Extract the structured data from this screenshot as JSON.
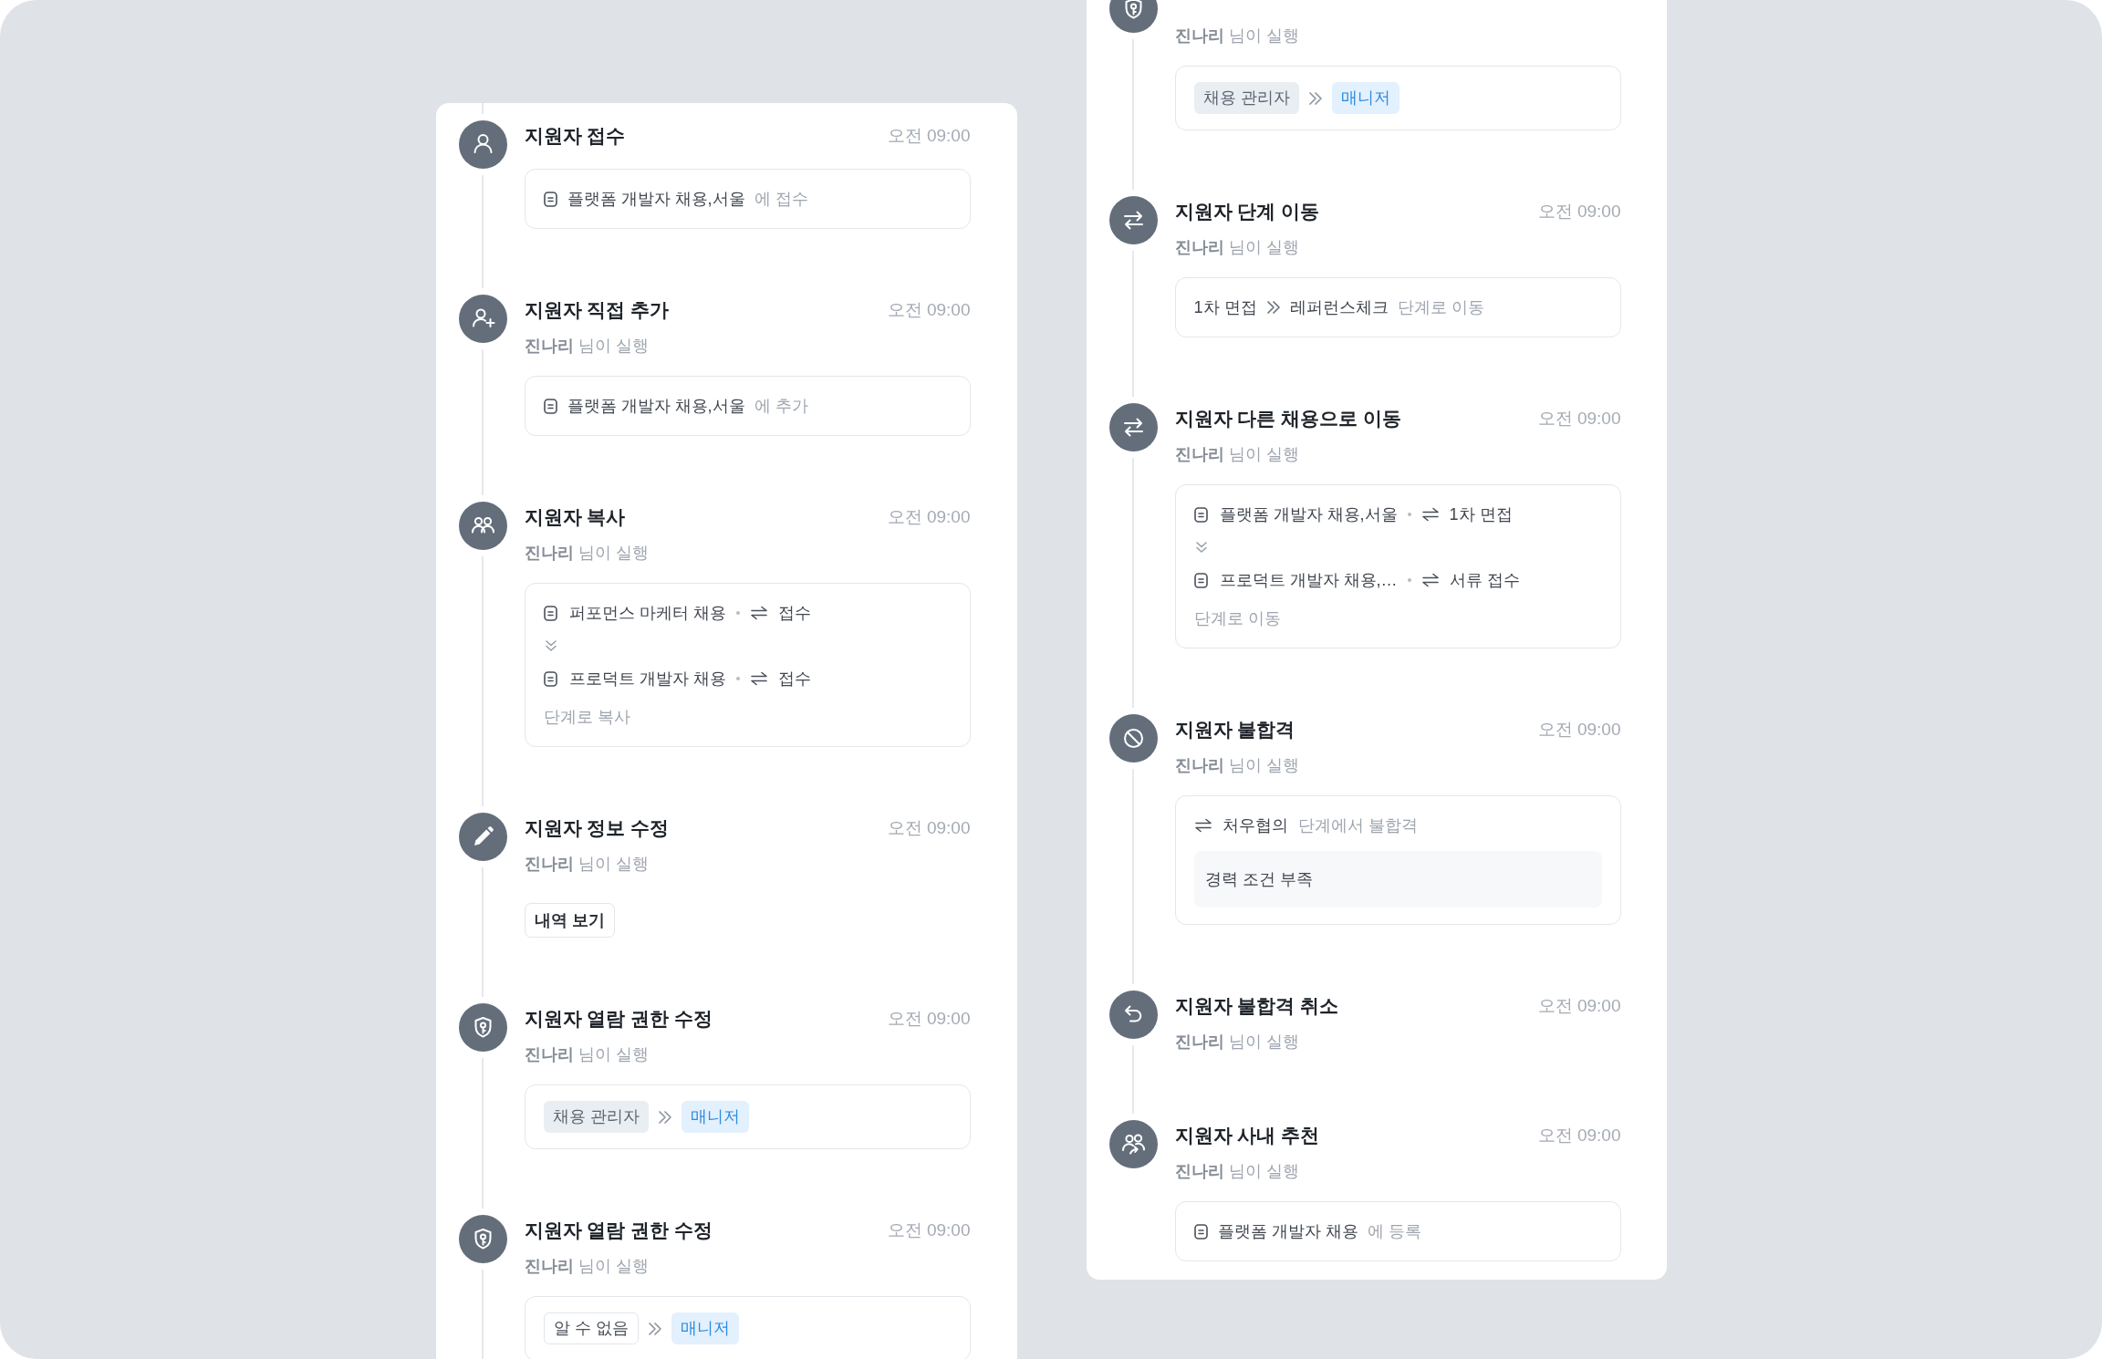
{
  "columns": [
    {
      "continues": true,
      "events": [
        {
          "kind": "apply",
          "title": "지원자 접수",
          "time": "오전 09:00",
          "detail": {
            "kind": "posting",
            "posting": "플랫폼 개발자 채용,서울",
            "suffix": "에 접수"
          }
        },
        {
          "kind": "add",
          "title": "지원자 직접 추가",
          "time": "오전 09:00",
          "actor": "**진나리** 님이 실행",
          "detail": {
            "kind": "posting",
            "posting": "플랫폼 개발자 채용,서울",
            "suffix": "에 추가"
          }
        },
        {
          "kind": "copy",
          "title": "지원자 복사",
          "time": "오전 09:00",
          "actor": "**진나리** 님이 실행",
          "detail": {
            "kind": "transfer",
            "rows": [
              {
                "posting": "퍼포먼스 마케터 채용",
                "stage": "접수"
              },
              {
                "posting": "프로덕트 개발자 채용",
                "stage": "접수"
              }
            ],
            "note": "단계로 복사"
          }
        },
        {
          "kind": "edit",
          "title": "지원자 정보 수정",
          "time": "오전 09:00",
          "actor": "**진나리** 님이 실행",
          "detail": {
            "kind": "button",
            "label": "내역 보기"
          }
        },
        {
          "kind": "access",
          "title": "지원자 열람 권한 수정",
          "time": "오전 09:00",
          "actor": "**진나리** 님이 실행",
          "detail": {
            "kind": "roles",
            "chips": [
              {
                "kind": "old",
                "label": "채용 관리자"
              },
              {
                "kind": "new",
                "label": "매니저"
              }
            ]
          }
        },
        {
          "kind": "access",
          "title": "지원자 열람 권한 수정",
          "time": "오전 09:00",
          "actor": "**진나리** 님이 실행",
          "detail": {
            "kind": "roles",
            "chips": [
              {
                "kind": "unknown",
                "label": "알 수 없음"
              },
              {
                "kind": "new",
                "label": "매니저"
              }
            ]
          }
        }
      ]
    },
    {
      "continues": false,
      "events": [
        {
          "kind": "access",
          "actor": "**진나리** 님이 실행",
          "detail": {
            "kind": "roles",
            "chips": [
              {
                "kind": "old",
                "label": "채용 관리자"
              },
              {
                "kind": "new",
                "label": "매니저"
              }
            ]
          }
        },
        {
          "kind": "stage",
          "title": "지원자 단계 이동",
          "time": "오전 09:00",
          "actor": "**진나리** 님이 실행",
          "detail": {
            "kind": "stage",
            "from": "1차 면접",
            "to": "레퍼런스체크",
            "suffix": "단계로 이동"
          }
        },
        {
          "kind": "move",
          "title": "지원자 다른 채용으로 이동",
          "time": "오전 09:00",
          "actor": "**진나리** 님이 실행",
          "detail": {
            "kind": "transfer",
            "rows": [
              {
                "posting": "플랫폼 개발자 채용,서울",
                "stage": "1차 면접"
              },
              {
                "posting": "프로덕트 개발자 채용,…",
                "stage": "서류 접수"
              }
            ],
            "note": "단계로 이동"
          }
        },
        {
          "kind": "reject",
          "title": "지원자 불합격",
          "time": "오전 09:00",
          "actor": "**진나리** 님이 실행",
          "detail": {
            "kind": "reject",
            "stage": "처우협의",
            "suffix": "단계에서 불합격",
            "reason": "경력 조건 부족"
          }
        },
        {
          "kind": "undo",
          "title": "지원자 불합격 취소",
          "time": "오전 09:00",
          "actor": "**진나리** 님이 실행"
        },
        {
          "kind": "referral",
          "title": "지원자 사내 추천",
          "time": "오전 09:00",
          "actor": "**진나리** 님이 실행",
          "detail": {
            "kind": "posting",
            "posting": "플랫폼 개발자 채용",
            "suffix": "에 등록"
          }
        }
      ]
    }
  ]
}
